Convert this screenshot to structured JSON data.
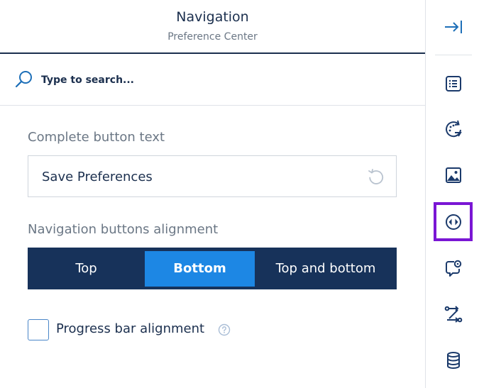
{
  "header": {
    "title": "Navigation",
    "subtitle": "Preference Center"
  },
  "search": {
    "placeholder": "Type to search..."
  },
  "complete_button": {
    "label": "Complete button text",
    "value": "Save Preferences"
  },
  "alignment": {
    "label": "Navigation buttons alignment",
    "options": [
      "Top",
      "Bottom",
      "Top and bottom"
    ],
    "selected": "Bottom"
  },
  "progress_bar": {
    "label": "Progress bar alignment",
    "checked": false
  },
  "sidebar": {
    "icons": [
      "collapse-panel-icon",
      "list-icon",
      "refresh-palette-icon",
      "image-icon",
      "navigation-icon",
      "settings-chat-icon",
      "flow-icon",
      "database-icon"
    ],
    "active": "navigation-icon"
  },
  "colors": {
    "primary": "#1b2f4e",
    "segment_bg": "#17325a",
    "segment_active": "#1d87e4",
    "active_outline": "#7a16d4",
    "muted_text": "#6b7785"
  }
}
